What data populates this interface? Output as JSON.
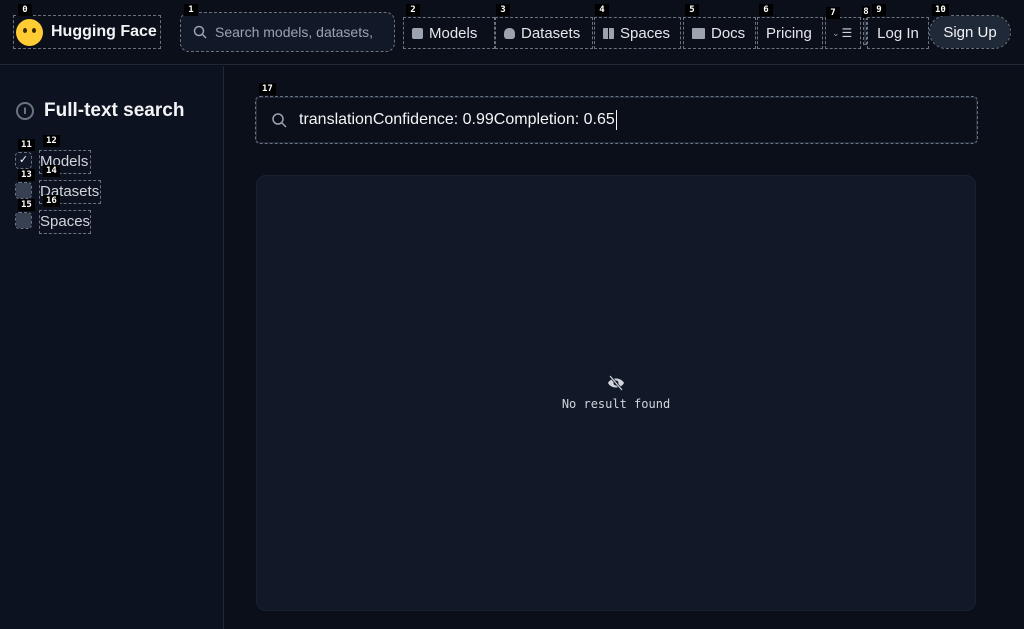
{
  "header": {
    "brand": "Hugging Face",
    "search_placeholder": "Search models, datasets,",
    "nav": {
      "models": "Models",
      "datasets": "Datasets",
      "spaces": "Spaces",
      "docs": "Docs",
      "pricing": "Pricing"
    },
    "login": "Log In",
    "signup": "Sign Up"
  },
  "sidebar": {
    "title": "Full-text search",
    "filters": [
      {
        "label": "Models",
        "checked": true
      },
      {
        "label": "Datasets",
        "checked": false
      },
      {
        "label": "Spaces",
        "checked": false
      }
    ]
  },
  "search": {
    "value": "translationConfidence: 0.99Completion: 0.65"
  },
  "results": {
    "empty_message": "No result found"
  },
  "markers": [
    "0",
    "1",
    "2",
    "3",
    "4",
    "5",
    "6",
    "7",
    "8",
    "9",
    "10",
    "11",
    "12",
    "13",
    "14",
    "15",
    "16",
    "17"
  ],
  "colors": {
    "background": "#0b0f19",
    "panel": "#111827",
    "brand_yellow": "#ffcc33"
  }
}
